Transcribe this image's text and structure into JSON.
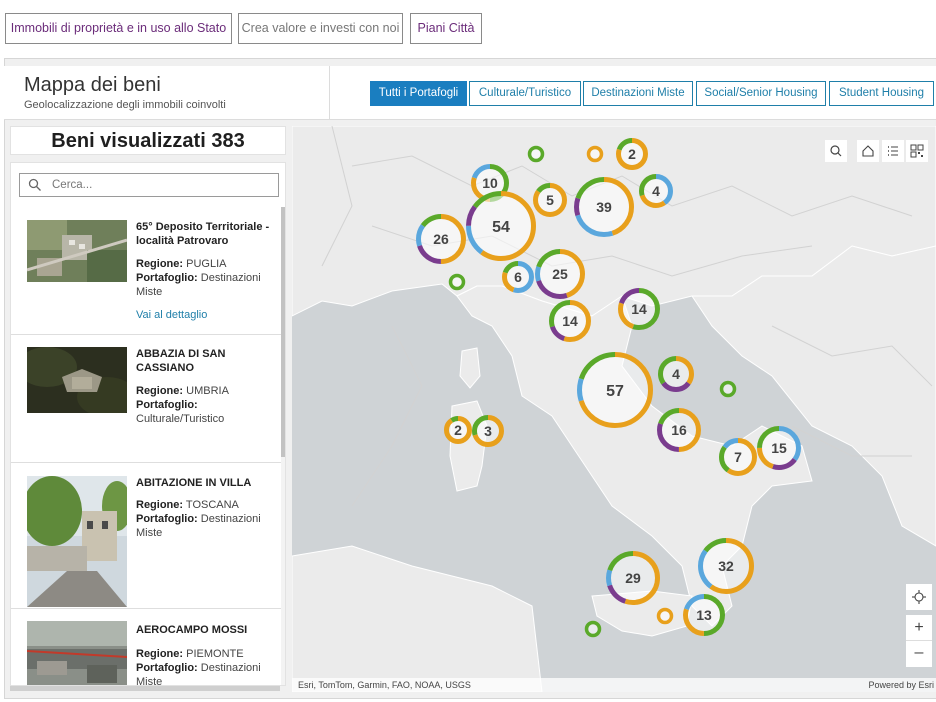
{
  "top_tabs": [
    {
      "label": "Immobili di proprietà e in uso allo Stato",
      "color": "#6b2c7a"
    },
    {
      "label": "Crea valore e investi con noi",
      "color": "#777777"
    },
    {
      "label": "Piani Città",
      "color": "#6b2c7a"
    }
  ],
  "header": {
    "title": "Mappa dei beni",
    "subtitle": "Geolocalizzazione degli immobili coinvolti"
  },
  "filters": [
    {
      "label": "Tutti i Portafogli",
      "active": true
    },
    {
      "label": "Culturale/Turistico",
      "active": false
    },
    {
      "label": "Destinazioni Miste",
      "active": false
    },
    {
      "label": "Social/Senior Housing",
      "active": false
    },
    {
      "label": "Student Housing",
      "active": false
    }
  ],
  "count": {
    "text": "Beni visualizzati 383"
  },
  "search": {
    "placeholder": "Cerca..."
  },
  "list": {
    "region_label": "Regione:",
    "portfolio_label": "Portafoglio:",
    "detail_link": "Vai al dettaglio",
    "items": [
      {
        "name": "65° Deposito Territoriale - località Patrovaro",
        "region": "PUGLIA",
        "portfolio": "Destinazioni Miste",
        "has_link": true
      },
      {
        "name": "ABBAZIA DI SAN CASSIANO",
        "region": "UMBRIA",
        "portfolio": "Culturale/Turistico"
      },
      {
        "name": "ABITAZIONE IN VILLA",
        "region": "TOSCANA",
        "portfolio": "Destinazioni Miste"
      },
      {
        "name": "AEROCAMPO MOSSI",
        "region": "PIEMONTE",
        "portfolio": "Destinazioni Miste"
      }
    ]
  },
  "map": {
    "attribution": "Esri, TomTom, Garmin, FAO, NOAA, USGS",
    "powered_by": "Powered by Esri",
    "tools": [
      "search-icon",
      "home-icon",
      "legend-list-icon",
      "qr-grid-icon",
      "locate-icon",
      "zoom-in-icon",
      "zoom-out-icon"
    ],
    "zoom_in": "+",
    "zoom_out": "–",
    "colors": {
      "green": "#5aa92a",
      "orange": "#e8a01c",
      "purple": "#7a3c8e",
      "blue": "#5aa7dd"
    },
    "clusters": [
      {
        "label": "2"
      },
      {
        "label": "10"
      },
      {
        "label": "5"
      },
      {
        "label": "4"
      },
      {
        "label": "39"
      },
      {
        "label": "54"
      },
      {
        "label": "26"
      },
      {
        "label": "6"
      },
      {
        "label": "25"
      },
      {
        "label": "14"
      },
      {
        "label": "14"
      },
      {
        "label": "57"
      },
      {
        "label": "4"
      },
      {
        "label": "16"
      },
      {
        "label": "2"
      },
      {
        "label": "3"
      },
      {
        "label": "7"
      },
      {
        "label": "15"
      },
      {
        "label": "29"
      },
      {
        "label": "32"
      },
      {
        "label": "13"
      },
      {
        "label": ""
      },
      {
        "label": ""
      },
      {
        "label": ""
      },
      {
        "label": ""
      },
      {
        "label": ""
      },
      {
        "label": ""
      }
    ]
  }
}
